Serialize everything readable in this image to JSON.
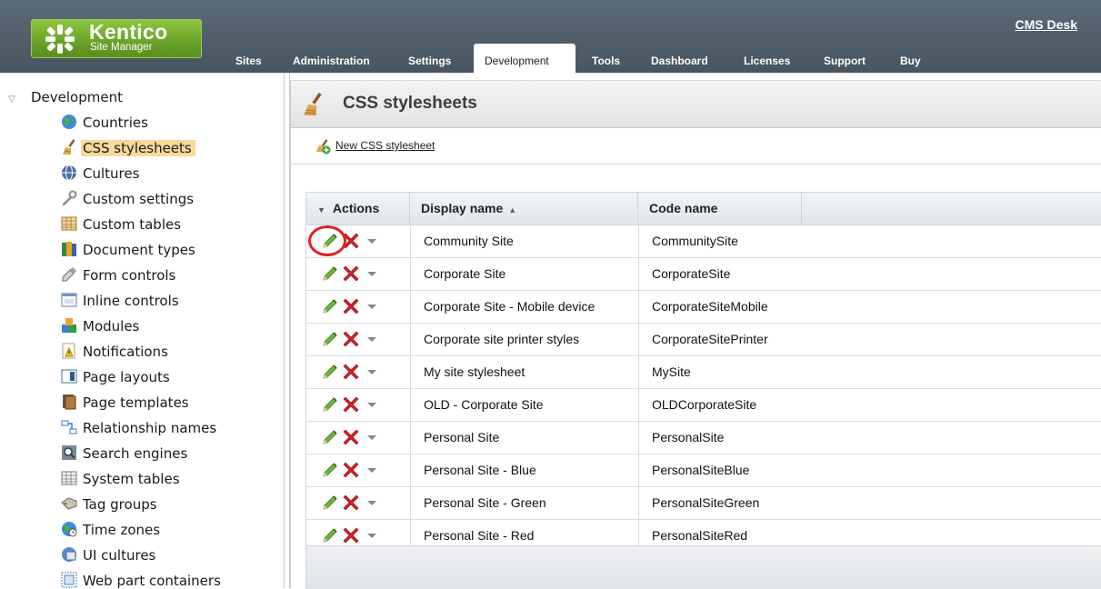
{
  "header": {
    "logo": {
      "brand": "Kentico",
      "product": "Site Manager"
    },
    "cms_desk_link": "CMS Desk",
    "tabs": [
      {
        "label": "Sites",
        "active": false
      },
      {
        "label": "Administration",
        "active": false
      },
      {
        "label": "Settings",
        "active": false
      },
      {
        "label": "Development",
        "active": true
      },
      {
        "label": "Tools",
        "active": false
      },
      {
        "label": "Dashboard",
        "active": false
      },
      {
        "label": "Licenses",
        "active": false
      },
      {
        "label": "Support",
        "active": false
      },
      {
        "label": "Buy",
        "active": false
      }
    ]
  },
  "sidebar": {
    "root": {
      "label": "Development",
      "expanded": true
    },
    "items": [
      {
        "label": "Countries",
        "icon": "globe-icon"
      },
      {
        "label": "CSS stylesheets",
        "icon": "broom-icon",
        "selected": true
      },
      {
        "label": "Cultures",
        "icon": "culture-globe-icon"
      },
      {
        "label": "Custom settings",
        "icon": "wrench-icon"
      },
      {
        "label": "Custom tables",
        "icon": "table-grid-icon"
      },
      {
        "label": "Document types",
        "icon": "books-icon"
      },
      {
        "label": "Form controls",
        "icon": "form-pencil-icon"
      },
      {
        "label": "Inline controls",
        "icon": "window-icon"
      },
      {
        "label": "Modules",
        "icon": "puzzle-icon"
      },
      {
        "label": "Notifications",
        "icon": "notification-icon"
      },
      {
        "label": "Page layouts",
        "icon": "layout-icon"
      },
      {
        "label": "Page templates",
        "icon": "template-icon"
      },
      {
        "label": "Relationship names",
        "icon": "relationship-icon"
      },
      {
        "label": "Search engines",
        "icon": "search-engine-icon"
      },
      {
        "label": "System tables",
        "icon": "system-table-icon"
      },
      {
        "label": "Tag groups",
        "icon": "tag-icon"
      },
      {
        "label": "Time zones",
        "icon": "clock-globe-icon"
      },
      {
        "label": "UI cultures",
        "icon": "ui-culture-icon"
      },
      {
        "label": "Web part containers",
        "icon": "container-icon"
      }
    ]
  },
  "main": {
    "page_title": "CSS stylesheets",
    "new_action": "New CSS stylesheet",
    "grid": {
      "columns": {
        "actions": "Actions",
        "display_name": "Display name",
        "code_name": "Code name"
      },
      "sort": {
        "column": "display_name",
        "direction": "asc"
      },
      "highlighted_row": 0,
      "rows": [
        {
          "display_name": "Community Site",
          "code_name": "CommunitySite"
        },
        {
          "display_name": "Corporate Site",
          "code_name": "CorporateSite"
        },
        {
          "display_name": "Corporate Site - Mobile device",
          "code_name": "CorporateSiteMobile"
        },
        {
          "display_name": "Corporate site printer styles",
          "code_name": "CorporateSitePrinter"
        },
        {
          "display_name": "My site stylesheet",
          "code_name": "MySite"
        },
        {
          "display_name": "OLD - Corporate Site",
          "code_name": "OLDCorporateSite"
        },
        {
          "display_name": "Personal Site",
          "code_name": "PersonalSite"
        },
        {
          "display_name": "Personal Site - Blue",
          "code_name": "PersonalSiteBlue"
        },
        {
          "display_name": "Personal Site - Green",
          "code_name": "PersonalSiteGreen"
        },
        {
          "display_name": "Personal Site - Red",
          "code_name": "PersonalSiteRed"
        }
      ]
    }
  },
  "colors": {
    "header_bg": "#4e5b66",
    "logo_green": "#7ab535",
    "selected_tree_item": "#f9d999",
    "highlight_circle": "#e12222"
  }
}
